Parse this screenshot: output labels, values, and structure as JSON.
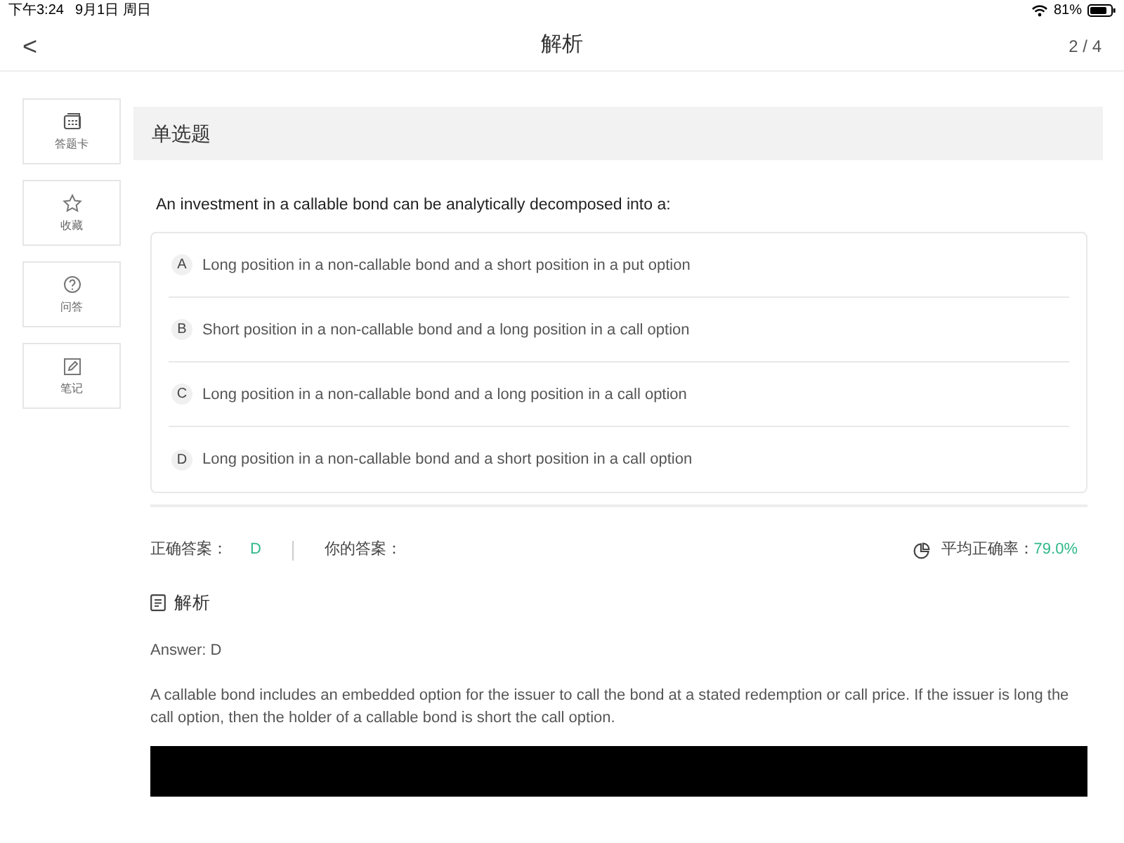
{
  "status_bar": {
    "time": "下午3:24",
    "date": "9月1日 周日",
    "battery": "81%"
  },
  "nav": {
    "back": "<",
    "title": "解析",
    "progress": "2 / 4"
  },
  "sidebar": {
    "items": [
      {
        "kind": "card",
        "label": "答题卡"
      },
      {
        "kind": "star",
        "label": "收藏"
      },
      {
        "kind": "question",
        "label": "问答"
      },
      {
        "kind": "note",
        "label": "笔记"
      }
    ]
  },
  "question": {
    "type": "单选题",
    "text": "An investment in a callable bond can be analytically decomposed into a:",
    "options": [
      {
        "letter": "A",
        "text": "Long position in a non-callable bond and a short position in a put option"
      },
      {
        "letter": "B",
        "text": "Short position in a non-callable bond and a long position in a call option"
      },
      {
        "letter": "C",
        "text": "Long position in a non-callable bond and a long position in a call option"
      },
      {
        "letter": "D",
        "text": "Long position in a non-callable bond and a short position in a call option"
      }
    ]
  },
  "result": {
    "correct_label": "正确答案：",
    "correct_value": "D",
    "your_label": "你的答案：",
    "average_label": "平均正确率：",
    "average_value": "79.0%"
  },
  "analysis": {
    "title": "解析",
    "answer": "Answer: D",
    "explanation": "A callable bond includes an embedded option for the issuer to call the bond at a stated redemption or call price. If the issuer is long the call option, then the holder of a callable bond is short the call option.",
    "media": {
      "kind": "video"
    }
  }
}
